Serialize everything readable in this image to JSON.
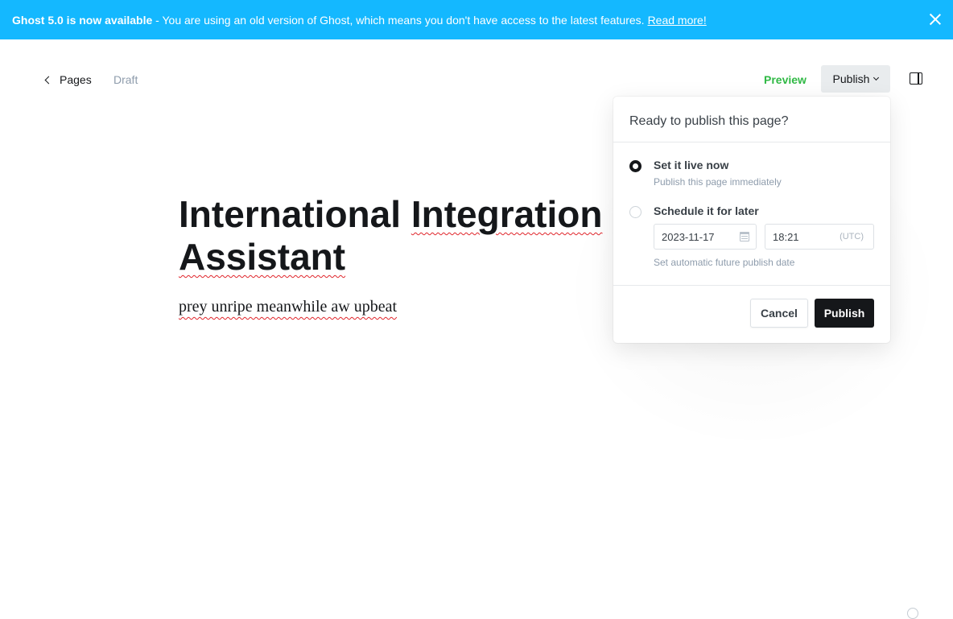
{
  "banner": {
    "strong": "Ghost 5.0 is now available",
    "message": " - You are using an old version of Ghost, which means you don't have access to the latest features.",
    "link": "Read more!",
    "close_icon": "close-icon",
    "color": "#14b8ff"
  },
  "editor_bar": {
    "back_label": "Pages",
    "status": "Draft",
    "preview_label": "Preview",
    "publish_label": "Publish",
    "sidebar_icon": "sidebar-toggle-icon"
  },
  "content": {
    "title_line1_a": "International",
    "title_line1_b": "Integration",
    "title_line2": "Assistant",
    "body": "prey unripe meanwhile aw upbeat"
  },
  "publish_menu": {
    "header": "Ready to publish this page?",
    "option_now": {
      "title": "Set it live now",
      "desc": "Publish this page immediately",
      "selected": true
    },
    "option_schedule": {
      "title": "Schedule it for later",
      "selected": false,
      "date": "2023-11-17",
      "time": "18:21",
      "timezone": "(UTC)",
      "hint": "Set automatic future publish date"
    },
    "cancel_label": "Cancel",
    "publish_label": "Publish"
  },
  "colors": {
    "accent_green": "#30b945",
    "primary_button": "#15171a"
  }
}
